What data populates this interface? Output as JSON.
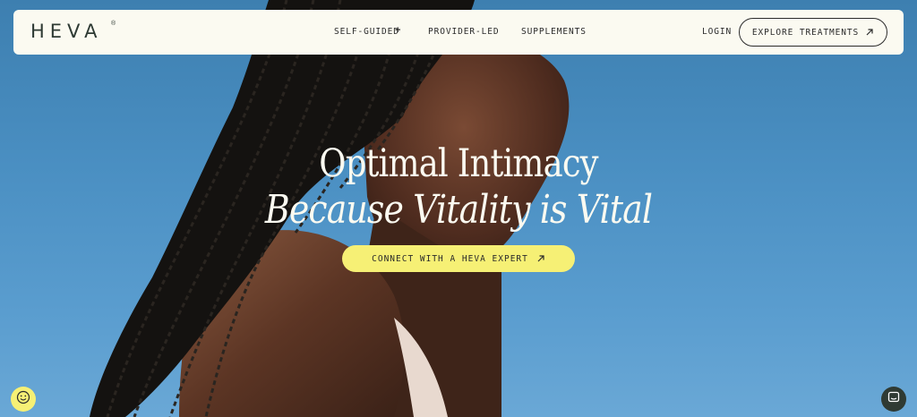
{
  "brand": {
    "logo_text": "HEVA",
    "registered_mark": "®"
  },
  "nav": {
    "items": [
      {
        "label": "SELF-GUIDED",
        "has_plus": true,
        "plus": "+"
      },
      {
        "label": "PROVIDER-LED"
      },
      {
        "label": "SUPPLEMENTS"
      }
    ],
    "login_label": "LOGIN",
    "explore_label": "EXPLORE TREATMENTS",
    "explore_icon": "arrow-up-right-icon"
  },
  "hero": {
    "title": "Optimal Intimacy",
    "subtitle": "Because Vitality is Vital",
    "cta_label": "CONNECT WITH A HEVA EXPERT",
    "cta_icon": "arrow-up-right-icon",
    "background_image": "woman-with-braids-against-blue-sky"
  },
  "widgets": {
    "accessibility_icon": "smiley-face-icon",
    "chat_icon": "chat-bubble-icon"
  },
  "colors": {
    "nav_bg": "#fbfaf1",
    "text_dark": "#2b2b2b",
    "cta_yellow": "#f6f075",
    "sky_blue": "#4a8fc2",
    "hero_text": "#fbfaf1",
    "chat_bg": "#2f3a33"
  }
}
